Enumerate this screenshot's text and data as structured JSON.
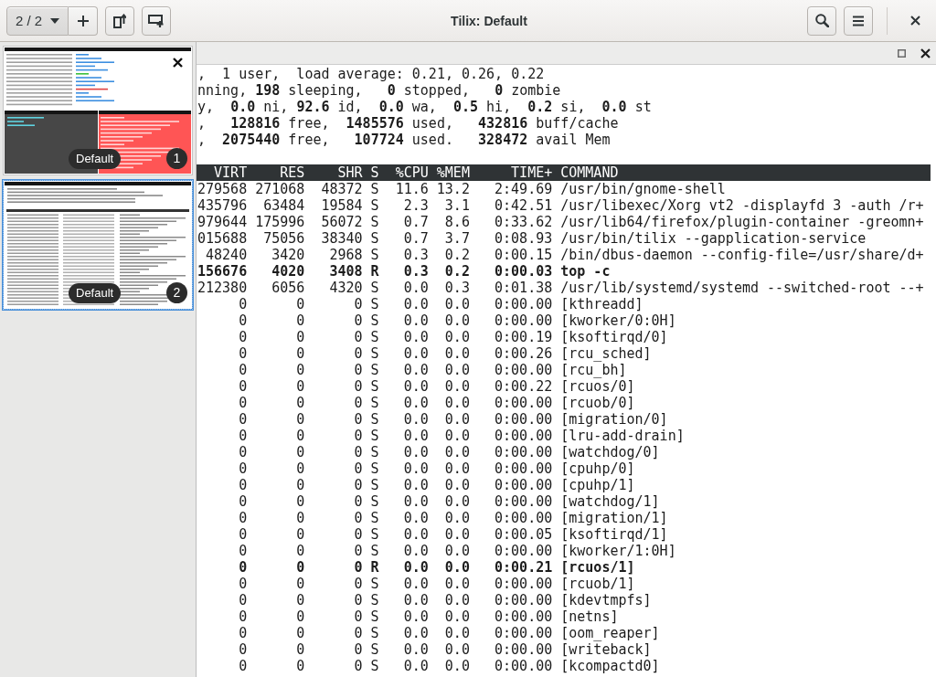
{
  "header_bar": {
    "session_switcher": {
      "label": "2 / 2"
    },
    "title": "Tilix: Default"
  },
  "sidebar": {
    "sessions": [
      {
        "kind": "split",
        "name": "Default",
        "number": "1",
        "selected": false,
        "hovered": true
      },
      {
        "kind": "single",
        "name": "Default",
        "number": "2",
        "selected": true,
        "hovered": false
      }
    ]
  },
  "terminal": {
    "summary_lines": [
      ",  1 user,  load average: 0.21, 0.26, 0.22",
      "nning, **198** sleeping,   **0** stopped,   **0** zombie",
      "y,  **0.0** ni, **92.6** id,  **0.0** wa,  **0.5** hi,  **0.2** si,  **0.0** st",
      ",   **128816** free,  **1485576** used,   **432816** buff/cache",
      ",  **2075440** free,   **107724** used.   **328472** avail Mem"
    ],
    "process_table": {
      "columns": [
        "VIRT",
        "RES",
        "SHR",
        "S",
        "%CPU",
        "%MEM",
        "TIME+",
        "COMMAND"
      ],
      "rows": [
        {
          "cells": [
            "279568",
            "271068",
            "48372",
            "S",
            "11.6",
            "13.2",
            "2:49.69",
            "/usr/bin/gnome-shell"
          ],
          "highlighted": false
        },
        {
          "cells": [
            "435796",
            "63484",
            "19584",
            "S",
            "2.3",
            "3.1",
            "0:42.51",
            "/usr/libexec/Xorg vt2 -displayfd 3 -auth /r+"
          ],
          "highlighted": false
        },
        {
          "cells": [
            "979644",
            "175996",
            "56072",
            "S",
            "0.7",
            "8.6",
            "0:33.62",
            "/usr/lib64/firefox/plugin-container -greomn+"
          ],
          "highlighted": false
        },
        {
          "cells": [
            "015688",
            "75056",
            "38340",
            "S",
            "0.7",
            "3.7",
            "0:08.93",
            "/usr/bin/tilix --gapplication-service"
          ],
          "highlighted": false
        },
        {
          "cells": [
            "48240",
            "3420",
            "2968",
            "S",
            "0.3",
            "0.2",
            "0:00.15",
            "/bin/dbus-daemon --config-file=/usr/share/d+"
          ],
          "highlighted": false
        },
        {
          "cells": [
            "156676",
            "4020",
            "3408",
            "R",
            "0.3",
            "0.2",
            "0:00.03",
            "top -c"
          ],
          "highlighted": true
        },
        {
          "cells": [
            "212380",
            "6056",
            "4320",
            "S",
            "0.0",
            "0.3",
            "0:01.38",
            "/usr/lib/systemd/systemd --switched-root --+"
          ],
          "highlighted": false
        },
        {
          "cells": [
            "0",
            "0",
            "0",
            "S",
            "0.0",
            "0.0",
            "0:00.00",
            "[kthreadd]"
          ],
          "highlighted": false
        },
        {
          "cells": [
            "0",
            "0",
            "0",
            "S",
            "0.0",
            "0.0",
            "0:00.00",
            "[kworker/0:0H]"
          ],
          "highlighted": false
        },
        {
          "cells": [
            "0",
            "0",
            "0",
            "S",
            "0.0",
            "0.0",
            "0:00.19",
            "[ksoftirqd/0]"
          ],
          "highlighted": false
        },
        {
          "cells": [
            "0",
            "0",
            "0",
            "S",
            "0.0",
            "0.0",
            "0:00.26",
            "[rcu_sched]"
          ],
          "highlighted": false
        },
        {
          "cells": [
            "0",
            "0",
            "0",
            "S",
            "0.0",
            "0.0",
            "0:00.00",
            "[rcu_bh]"
          ],
          "highlighted": false
        },
        {
          "cells": [
            "0",
            "0",
            "0",
            "S",
            "0.0",
            "0.0",
            "0:00.22",
            "[rcuos/0]"
          ],
          "highlighted": false
        },
        {
          "cells": [
            "0",
            "0",
            "0",
            "S",
            "0.0",
            "0.0",
            "0:00.00",
            "[rcuob/0]"
          ],
          "highlighted": false
        },
        {
          "cells": [
            "0",
            "0",
            "0",
            "S",
            "0.0",
            "0.0",
            "0:00.00",
            "[migration/0]"
          ],
          "highlighted": false
        },
        {
          "cells": [
            "0",
            "0",
            "0",
            "S",
            "0.0",
            "0.0",
            "0:00.00",
            "[lru-add-drain]"
          ],
          "highlighted": false
        },
        {
          "cells": [
            "0",
            "0",
            "0",
            "S",
            "0.0",
            "0.0",
            "0:00.00",
            "[watchdog/0]"
          ],
          "highlighted": false
        },
        {
          "cells": [
            "0",
            "0",
            "0",
            "S",
            "0.0",
            "0.0",
            "0:00.00",
            "[cpuhp/0]"
          ],
          "highlighted": false
        },
        {
          "cells": [
            "0",
            "0",
            "0",
            "S",
            "0.0",
            "0.0",
            "0:00.00",
            "[cpuhp/1]"
          ],
          "highlighted": false
        },
        {
          "cells": [
            "0",
            "0",
            "0",
            "S",
            "0.0",
            "0.0",
            "0:00.00",
            "[watchdog/1]"
          ],
          "highlighted": false
        },
        {
          "cells": [
            "0",
            "0",
            "0",
            "S",
            "0.0",
            "0.0",
            "0:00.00",
            "[migration/1]"
          ],
          "highlighted": false
        },
        {
          "cells": [
            "0",
            "0",
            "0",
            "S",
            "0.0",
            "0.0",
            "0:00.05",
            "[ksoftirqd/1]"
          ],
          "highlighted": false
        },
        {
          "cells": [
            "0",
            "0",
            "0",
            "S",
            "0.0",
            "0.0",
            "0:00.00",
            "[kworker/1:0H]"
          ],
          "highlighted": false
        },
        {
          "cells": [
            "0",
            "0",
            "0",
            "R",
            "0.0",
            "0.0",
            "0:00.21",
            "[rcuos/1]"
          ],
          "highlighted": true
        },
        {
          "cells": [
            "0",
            "0",
            "0",
            "S",
            "0.0",
            "0.0",
            "0:00.00",
            "[rcuob/1]"
          ],
          "highlighted": false
        },
        {
          "cells": [
            "0",
            "0",
            "0",
            "S",
            "0.0",
            "0.0",
            "0:00.00",
            "[kdevtmpfs]"
          ],
          "highlighted": false
        },
        {
          "cells": [
            "0",
            "0",
            "0",
            "S",
            "0.0",
            "0.0",
            "0:00.00",
            "[netns]"
          ],
          "highlighted": false
        },
        {
          "cells": [
            "0",
            "0",
            "0",
            "S",
            "0.0",
            "0.0",
            "0:00.00",
            "[oom_reaper]"
          ],
          "highlighted": false
        },
        {
          "cells": [
            "0",
            "0",
            "0",
            "S",
            "0.0",
            "0.0",
            "0:00.00",
            "[writeback]"
          ],
          "highlighted": false
        },
        {
          "cells": [
            "0",
            "0",
            "0",
            "S",
            "0.0",
            "0.0",
            "0:00.00",
            "[kcompactd0]"
          ],
          "highlighted": false
        }
      ]
    }
  }
}
